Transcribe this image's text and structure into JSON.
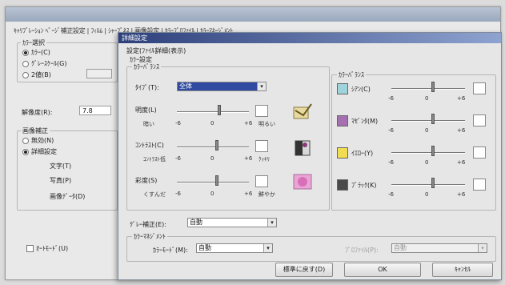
{
  "back_window": {
    "tabs_text": "ｷｬﾘﾌﾞﾚｰｼｮﾝ ﾍﾟｰｼﾞ補正設定 | ﾌｨﾙﾑ | ｼｬｰﾌﾟﾈｽ | 画像設定 | ｶﾗｰﾌﾟﾛﾌｧｲﾙ | ｶﾗｰﾏﾈｰｼﾞﾒﾝﾄ",
    "color_group_label": "ｶﾗｰ選択",
    "color_options": [
      "ｶﾗｰ(C)",
      "ｸﾞﾚｰｽｹｰﾙ(G)",
      "2値(B)"
    ],
    "resolution_label": "解像度(R):",
    "resolution_value": "7.8",
    "enhance_group_label": "画像補正",
    "enhance_options": [
      "無効(N)",
      "詳細設定"
    ],
    "enhance_items": [
      "文字(T)",
      "写真(P)",
      "画像ﾃﾞｰﾀ(D)"
    ],
    "auto_mode_label": "ｵｰﾄﾓｰﾄﾞ(U)"
  },
  "dialog": {
    "title": "詳細設定",
    "menu": [
      "設定(ﾌｧｲﾙ)",
      "詳細(表示)"
    ],
    "color_setting_label": "ｶﾗｰ設定",
    "color_adjust_label": "ｶﾗｰﾊﾞﾗﾝｽ",
    "type_label": "ﾀｲﾌﾟ(T):",
    "type_value": "全体",
    "sliders_left": [
      {
        "label": "明度(L)",
        "min_label": "暗い",
        "min": "-6",
        "mid": "0",
        "max": "+6",
        "max_label": "明るい",
        "level": 0.58,
        "icon": "brightness-image-icon"
      },
      {
        "label": "ｺﾝﾄﾗｽﾄ(C)",
        "min_label": "ｺﾝﾄﾗｽﾄ低",
        "min": "-6",
        "mid": "0",
        "max": "+6",
        "max_label": "ｸｯｷﾘ",
        "level": 0.55,
        "icon": "contrast-image-icon"
      },
      {
        "label": "彩度(S)",
        "min_label": "くすんだ",
        "min": "-6",
        "mid": "0",
        "max": "+6",
        "max_label": "鮮やか",
        "level": 0.55,
        "icon": "saturation-image-icon"
      }
    ],
    "color_balance_label": "ｶﾗｰﾊﾞﾗﾝｽ",
    "sliders_right": [
      {
        "label": "ｼｱﾝ(C)",
        "min": "-6",
        "mid": "0",
        "max": "+6",
        "level": 0.55,
        "color": "#9fd3dc"
      },
      {
        "label": "ﾏｾﾞﾝﾀ(M)",
        "min": "-6",
        "mid": "0",
        "max": "+6",
        "level": 0.55,
        "color": "#a66fb0"
      },
      {
        "label": "ｲｴﾛｰ(Y)",
        "min": "-6",
        "mid": "0",
        "max": "+6",
        "level": 0.55,
        "color": "#f2dd52"
      },
      {
        "label": "ﾌﾞﾗｯｸ(K)",
        "min": "-6",
        "mid": "0",
        "max": "+6",
        "level": 0.55,
        "color": "#4a4a4a"
      }
    ],
    "gray_label": "ｸﾞﾚｰ補正(E):",
    "gray_value": "自動",
    "mgmt_group_label": "ｶﾗｰﾏﾈｼﾞﾒﾝﾄ",
    "mgmt_left_label": "ｶﾗｰﾓｰﾄﾞ(M):",
    "mgmt_left_value": "自動",
    "mgmt_right_label": "ﾌﾟﾛﾌｧｲﾙ(P):",
    "mgmt_right_value": "自動",
    "buttons": {
      "reset": "標準に戻す(D)",
      "ok": "OK",
      "cancel": "ｷｬﾝｾﾙ"
    }
  }
}
